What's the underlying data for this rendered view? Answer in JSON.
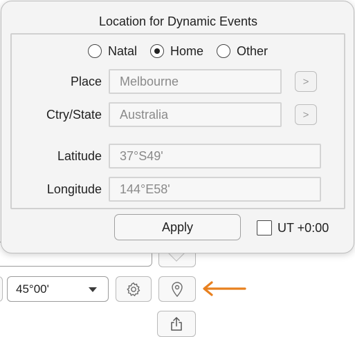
{
  "popover": {
    "title": "Location for Dynamic Events",
    "radios": [
      {
        "label": "Natal",
        "selected": false
      },
      {
        "label": "Home",
        "selected": true
      },
      {
        "label": "Other",
        "selected": false
      }
    ],
    "fields": {
      "place": {
        "label": "Place",
        "value": "Melbourne",
        "button": ">"
      },
      "country": {
        "label": "Ctry/State",
        "value": "Australia",
        "button": ">"
      },
      "latitude": {
        "label": "Latitude",
        "value": "37°S49'"
      },
      "longitude": {
        "label": "Longitude",
        "value": "144°E58'"
      }
    },
    "apply_label": "Apply",
    "ut_checkbox": {
      "label": "UT +0:00",
      "checked": false
    }
  },
  "toolbar": {
    "angle_select": {
      "value": "45°00'"
    },
    "icons": {
      "settings": "gear-icon",
      "location": "map-pin-icon",
      "share": "share-icon"
    }
  },
  "annotation": {
    "arrow_color": "#e8801f"
  }
}
